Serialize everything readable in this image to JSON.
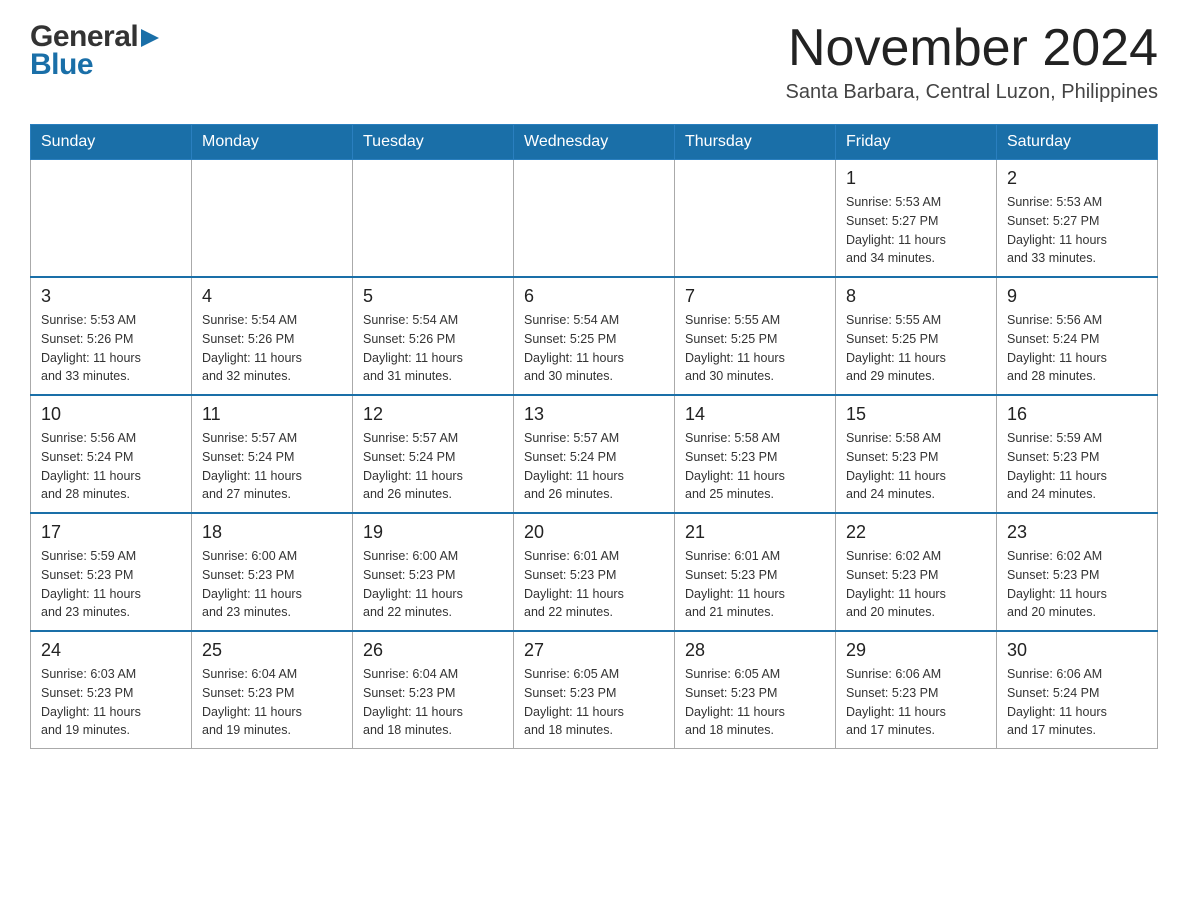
{
  "logo": {
    "general": "General",
    "blue": "Blue",
    "arrow": "▶"
  },
  "title": "November 2024",
  "location": "Santa Barbara, Central Luzon, Philippines",
  "days_header": [
    "Sunday",
    "Monday",
    "Tuesday",
    "Wednesday",
    "Thursday",
    "Friday",
    "Saturday"
  ],
  "weeks": [
    [
      {
        "day": "",
        "info": ""
      },
      {
        "day": "",
        "info": ""
      },
      {
        "day": "",
        "info": ""
      },
      {
        "day": "",
        "info": ""
      },
      {
        "day": "",
        "info": ""
      },
      {
        "day": "1",
        "info": "Sunrise: 5:53 AM\nSunset: 5:27 PM\nDaylight: 11 hours\nand 34 minutes."
      },
      {
        "day": "2",
        "info": "Sunrise: 5:53 AM\nSunset: 5:27 PM\nDaylight: 11 hours\nand 33 minutes."
      }
    ],
    [
      {
        "day": "3",
        "info": "Sunrise: 5:53 AM\nSunset: 5:26 PM\nDaylight: 11 hours\nand 33 minutes."
      },
      {
        "day": "4",
        "info": "Sunrise: 5:54 AM\nSunset: 5:26 PM\nDaylight: 11 hours\nand 32 minutes."
      },
      {
        "day": "5",
        "info": "Sunrise: 5:54 AM\nSunset: 5:26 PM\nDaylight: 11 hours\nand 31 minutes."
      },
      {
        "day": "6",
        "info": "Sunrise: 5:54 AM\nSunset: 5:25 PM\nDaylight: 11 hours\nand 30 minutes."
      },
      {
        "day": "7",
        "info": "Sunrise: 5:55 AM\nSunset: 5:25 PM\nDaylight: 11 hours\nand 30 minutes."
      },
      {
        "day": "8",
        "info": "Sunrise: 5:55 AM\nSunset: 5:25 PM\nDaylight: 11 hours\nand 29 minutes."
      },
      {
        "day": "9",
        "info": "Sunrise: 5:56 AM\nSunset: 5:24 PM\nDaylight: 11 hours\nand 28 minutes."
      }
    ],
    [
      {
        "day": "10",
        "info": "Sunrise: 5:56 AM\nSunset: 5:24 PM\nDaylight: 11 hours\nand 28 minutes."
      },
      {
        "day": "11",
        "info": "Sunrise: 5:57 AM\nSunset: 5:24 PM\nDaylight: 11 hours\nand 27 minutes."
      },
      {
        "day": "12",
        "info": "Sunrise: 5:57 AM\nSunset: 5:24 PM\nDaylight: 11 hours\nand 26 minutes."
      },
      {
        "day": "13",
        "info": "Sunrise: 5:57 AM\nSunset: 5:24 PM\nDaylight: 11 hours\nand 26 minutes."
      },
      {
        "day": "14",
        "info": "Sunrise: 5:58 AM\nSunset: 5:23 PM\nDaylight: 11 hours\nand 25 minutes."
      },
      {
        "day": "15",
        "info": "Sunrise: 5:58 AM\nSunset: 5:23 PM\nDaylight: 11 hours\nand 24 minutes."
      },
      {
        "day": "16",
        "info": "Sunrise: 5:59 AM\nSunset: 5:23 PM\nDaylight: 11 hours\nand 24 minutes."
      }
    ],
    [
      {
        "day": "17",
        "info": "Sunrise: 5:59 AM\nSunset: 5:23 PM\nDaylight: 11 hours\nand 23 minutes."
      },
      {
        "day": "18",
        "info": "Sunrise: 6:00 AM\nSunset: 5:23 PM\nDaylight: 11 hours\nand 23 minutes."
      },
      {
        "day": "19",
        "info": "Sunrise: 6:00 AM\nSunset: 5:23 PM\nDaylight: 11 hours\nand 22 minutes."
      },
      {
        "day": "20",
        "info": "Sunrise: 6:01 AM\nSunset: 5:23 PM\nDaylight: 11 hours\nand 22 minutes."
      },
      {
        "day": "21",
        "info": "Sunrise: 6:01 AM\nSunset: 5:23 PM\nDaylight: 11 hours\nand 21 minutes."
      },
      {
        "day": "22",
        "info": "Sunrise: 6:02 AM\nSunset: 5:23 PM\nDaylight: 11 hours\nand 20 minutes."
      },
      {
        "day": "23",
        "info": "Sunrise: 6:02 AM\nSunset: 5:23 PM\nDaylight: 11 hours\nand 20 minutes."
      }
    ],
    [
      {
        "day": "24",
        "info": "Sunrise: 6:03 AM\nSunset: 5:23 PM\nDaylight: 11 hours\nand 19 minutes."
      },
      {
        "day": "25",
        "info": "Sunrise: 6:04 AM\nSunset: 5:23 PM\nDaylight: 11 hours\nand 19 minutes."
      },
      {
        "day": "26",
        "info": "Sunrise: 6:04 AM\nSunset: 5:23 PM\nDaylight: 11 hours\nand 18 minutes."
      },
      {
        "day": "27",
        "info": "Sunrise: 6:05 AM\nSunset: 5:23 PM\nDaylight: 11 hours\nand 18 minutes."
      },
      {
        "day": "28",
        "info": "Sunrise: 6:05 AM\nSunset: 5:23 PM\nDaylight: 11 hours\nand 18 minutes."
      },
      {
        "day": "29",
        "info": "Sunrise: 6:06 AM\nSunset: 5:23 PM\nDaylight: 11 hours\nand 17 minutes."
      },
      {
        "day": "30",
        "info": "Sunrise: 6:06 AM\nSunset: 5:24 PM\nDaylight: 11 hours\nand 17 minutes."
      }
    ]
  ]
}
